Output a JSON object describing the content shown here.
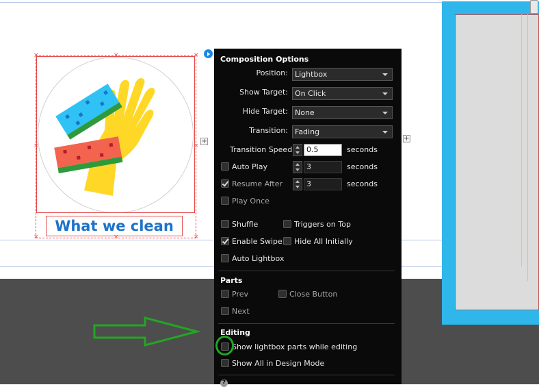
{
  "widget": {
    "caption": "What we clean",
    "image_alt": "Cleaning gloves and sponges icon"
  },
  "panel": {
    "composition_title": "Composition Options",
    "position": {
      "label": "Position:",
      "value": "Lightbox"
    },
    "show_target": {
      "label": "Show Target:",
      "value": "On Click"
    },
    "hide_target": {
      "label": "Hide Target:",
      "value": "None"
    },
    "transition": {
      "label": "Transition:",
      "value": "Fading"
    },
    "transition_speed": {
      "label": "Transition Speed:",
      "value": "0.5",
      "unit": "seconds"
    },
    "auto_play": {
      "label": "Auto Play",
      "checked": false,
      "value": "3",
      "unit": "seconds"
    },
    "resume_after": {
      "label": "Resume After",
      "checked": true,
      "value": "3",
      "unit": "seconds"
    },
    "play_once": {
      "label": "Play Once",
      "checked": false
    },
    "shuffle": {
      "label": "Shuffle",
      "checked": false
    },
    "triggers_on_top": {
      "label": "Triggers on Top",
      "checked": false
    },
    "enable_swipe": {
      "label": "Enable Swipe",
      "checked": true
    },
    "hide_all_initially": {
      "label": "Hide All Initially",
      "checked": false
    },
    "auto_lightbox": {
      "label": "Auto Lightbox",
      "checked": false
    },
    "parts_title": "Parts",
    "prev": {
      "label": "Prev",
      "checked": false
    },
    "close_button": {
      "label": "Close Button",
      "checked": false
    },
    "next": {
      "label": "Next",
      "checked": false
    },
    "editing_title": "Editing",
    "show_parts_editing": {
      "label": "Show lightbox parts while editing",
      "checked": false
    },
    "show_all_design": {
      "label": "Show All in Design Mode",
      "checked": false
    },
    "help_icon": "?"
  },
  "colors": {
    "panel_bg": "#0a0a0a",
    "accent_blue": "#2fb6ea",
    "annotation_green": "#23a623",
    "caption_blue": "#1c73c9"
  }
}
